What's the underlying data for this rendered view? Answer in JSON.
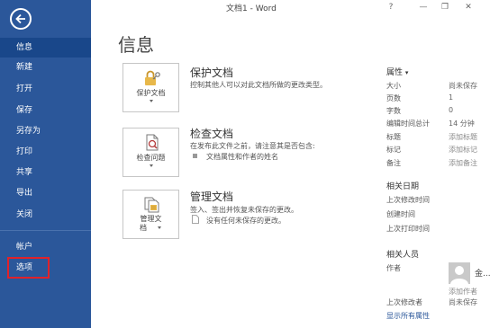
{
  "window": {
    "title": "文档1 - Word",
    "help": "?",
    "minimize": "—",
    "restore": "❐",
    "close": "✕"
  },
  "sidebar": {
    "back_icon": "back-arrow-icon",
    "items": [
      {
        "label": "信息",
        "selected": true
      },
      {
        "label": "新建"
      },
      {
        "label": "打开"
      },
      {
        "label": "保存"
      },
      {
        "label": "另存为"
      },
      {
        "label": "打印"
      },
      {
        "label": "共享"
      },
      {
        "label": "导出"
      },
      {
        "label": "关闭"
      },
      {
        "label": "帐户"
      },
      {
        "label": "选项",
        "highlighted": true
      }
    ],
    "highlight_color": "#e0222a",
    "background": "#2b579a"
  },
  "main": {
    "title": "信息",
    "sections": [
      {
        "button_label": "保护文档",
        "icon": "lock-key-icon",
        "heading": "保护文档",
        "description": "控制其他人可以对此文档所做的更改类型。",
        "sub_items": []
      },
      {
        "button_label": "检查问题",
        "icon": "document-check-icon",
        "heading": "检查文档",
        "description": "在发布此文件之前，请注意其是否包含:",
        "sub_items": [
          "文档属性和作者的姓名"
        ]
      },
      {
        "button_label_line1": "管理文",
        "button_label_line2": "档",
        "icon": "manage-documents-icon",
        "heading": "管理文档",
        "description": "签入、签出并恢复未保存的更改。",
        "sub_items": [
          "没有任何未保存的更改。"
        ]
      }
    ]
  },
  "properties": {
    "heading": "属性",
    "rows": [
      {
        "label": "大小",
        "value": "尚未保存"
      },
      {
        "label": "页数",
        "value": "1"
      },
      {
        "label": "字数",
        "value": "0"
      },
      {
        "label": "编辑时间总计",
        "value": "14 分钟"
      },
      {
        "label": "标题",
        "value": "添加标题"
      },
      {
        "label": "标记",
        "value": "添加标记"
      },
      {
        "label": "备注",
        "value": "添加备注"
      }
    ],
    "dates_heading": "相关日期",
    "dates": [
      "上次修改时间",
      "创建时间",
      "上次打印时间"
    ],
    "people_heading": "相关人员",
    "author_label": "作者",
    "author_name": "金...",
    "add_author": "添加作者",
    "last_modified_by_label": "上次修改者",
    "last_modified_by_value": "尚未保存",
    "show_all": "显示所有属性"
  }
}
